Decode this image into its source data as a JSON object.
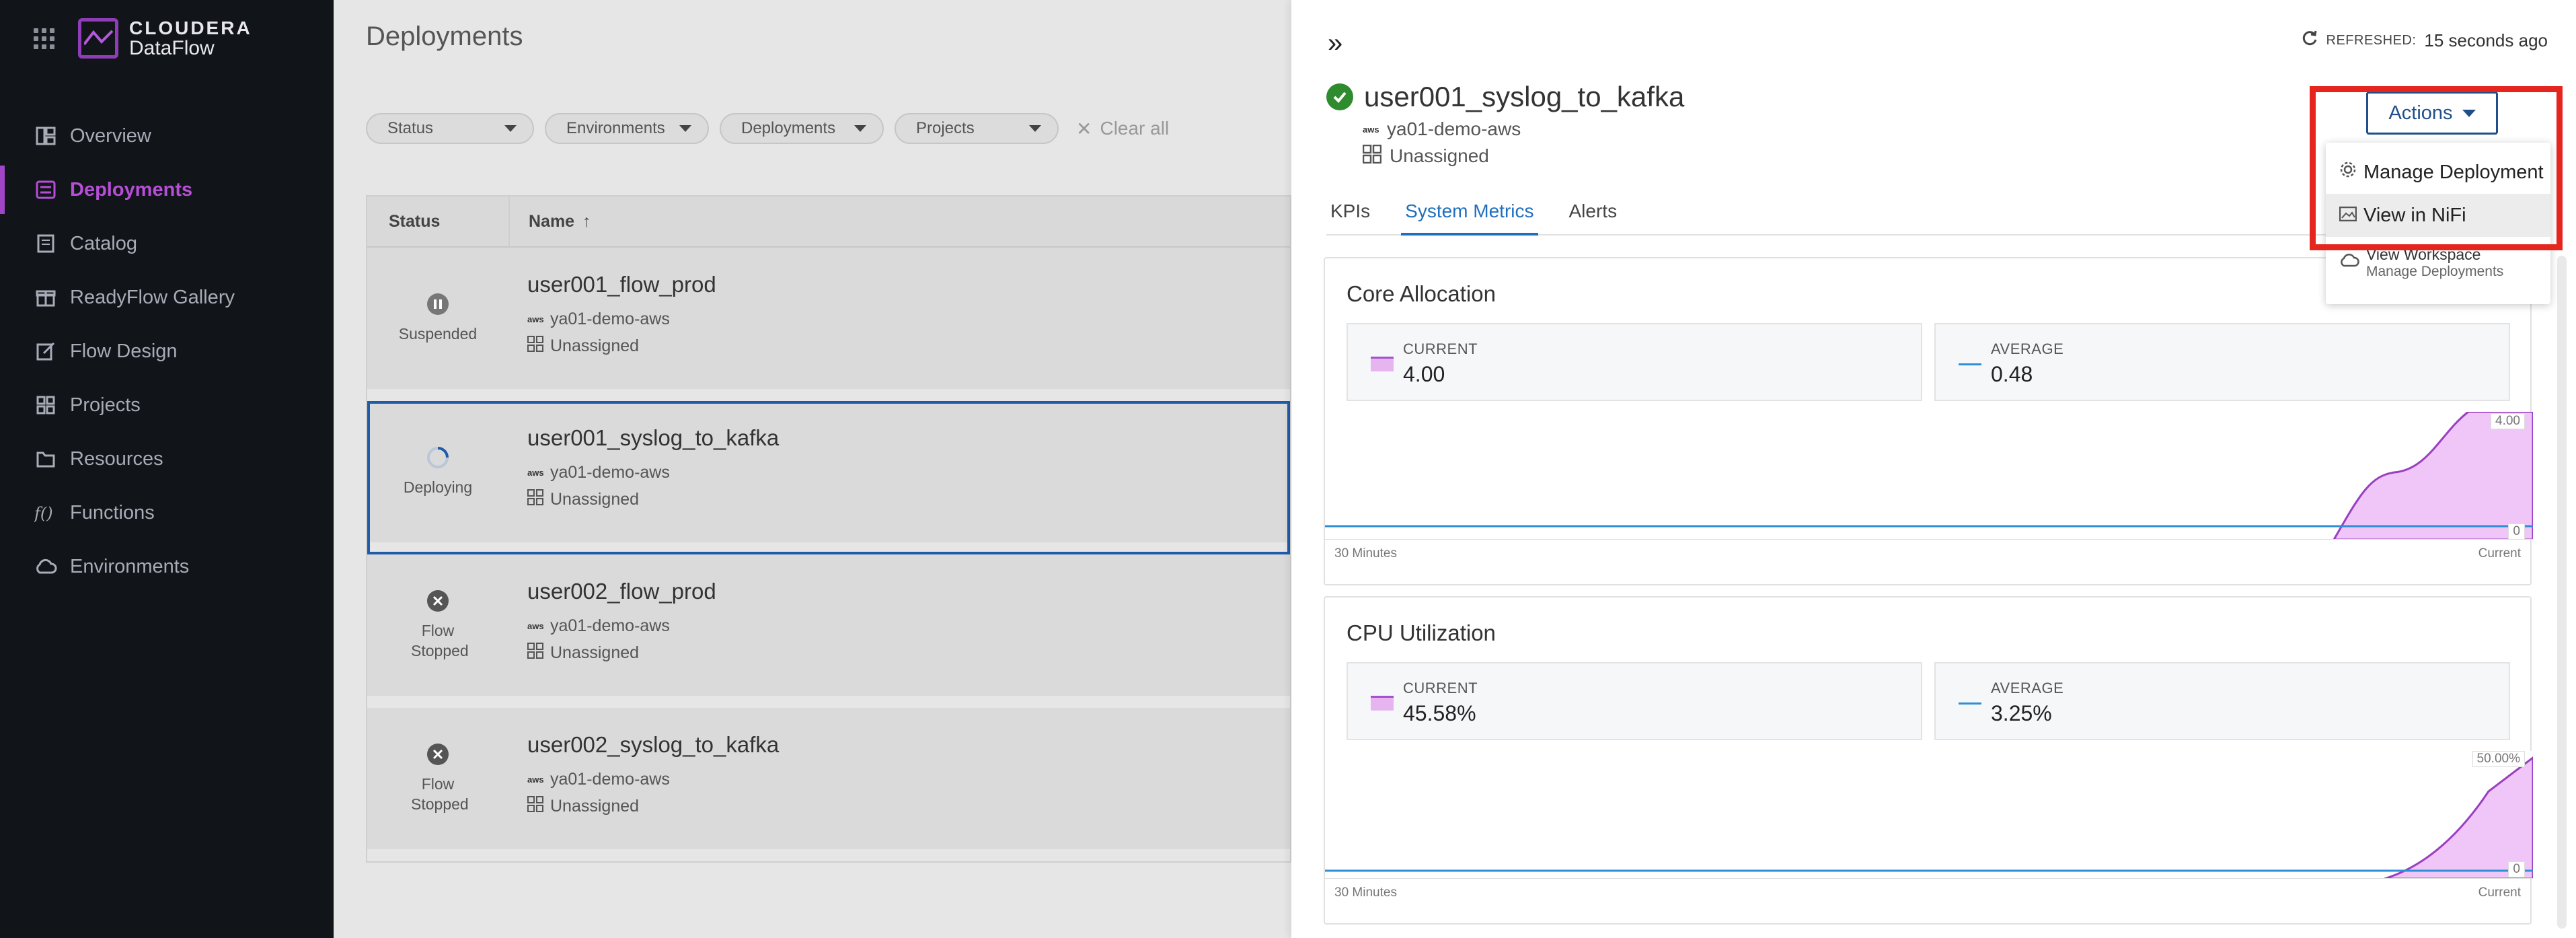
{
  "sidebar": {
    "brand_top": "CLOUDERA",
    "brand_bottom": "DataFlow",
    "items": [
      {
        "label": "Overview"
      },
      {
        "label": "Deployments"
      },
      {
        "label": "Catalog"
      },
      {
        "label": "ReadyFlow Gallery"
      },
      {
        "label": "Flow Design"
      },
      {
        "label": "Projects"
      },
      {
        "label": "Resources"
      },
      {
        "label": "Functions"
      },
      {
        "label": "Environments"
      }
    ]
  },
  "main": {
    "title": "Deployments",
    "filters": [
      "Status",
      "Environments",
      "Deployments",
      "Projects"
    ],
    "clear_all": "Clear all",
    "columns": {
      "status": "Status",
      "name": "Name"
    },
    "rows": [
      {
        "status": "Suspended",
        "name": "user001_flow_prod",
        "env": "ya01-demo-aws",
        "project": "Unassigned"
      },
      {
        "status": "Deploying",
        "name": "user001_syslog_to_kafka",
        "env": "ya01-demo-aws",
        "project": "Unassigned"
      },
      {
        "status": "Flow Stopped",
        "name": "user002_flow_prod",
        "env": "ya01-demo-aws",
        "project": "Unassigned"
      },
      {
        "status": "Flow Stopped",
        "name": "user002_syslog_to_kafka",
        "env": "ya01-demo-aws",
        "project": "Unassigned"
      }
    ]
  },
  "panel": {
    "refreshed_label": "REFRESHED:",
    "refreshed_value": "15 seconds ago",
    "deployment_name": "user001_syslog_to_kafka",
    "environment": "ya01-demo-aws",
    "project": "Unassigned",
    "aws_glyph": "aws",
    "tabs": [
      "KPIs",
      "System Metrics",
      "Alerts"
    ],
    "actions": {
      "label": "Actions",
      "items": [
        "Manage Deployment",
        "View in NiFi"
      ],
      "workspace_title": "View Workspace",
      "workspace_sub": "Manage Deployments"
    },
    "metrics": [
      {
        "title": "Core Allocation",
        "current_label": "CURRENT",
        "current_value": "4.00",
        "average_label": "AVERAGE",
        "average_value": "0.48",
        "max_label": "4.00",
        "min_label": "0",
        "x_start": "30 Minutes",
        "x_end": "Current"
      },
      {
        "title": "CPU Utilization",
        "current_label": "CURRENT",
        "current_value": "45.58%",
        "average_label": "AVERAGE",
        "average_value": "3.25%",
        "max_label": "50.00%",
        "min_label": "0",
        "x_start": "30 Minutes",
        "x_end": "Current"
      }
    ]
  },
  "colors": {
    "accent_purple": "#a145c8",
    "link_blue": "#1f6fbf",
    "highlight_red": "#e5261f",
    "success_green": "#2e8b2e"
  }
}
